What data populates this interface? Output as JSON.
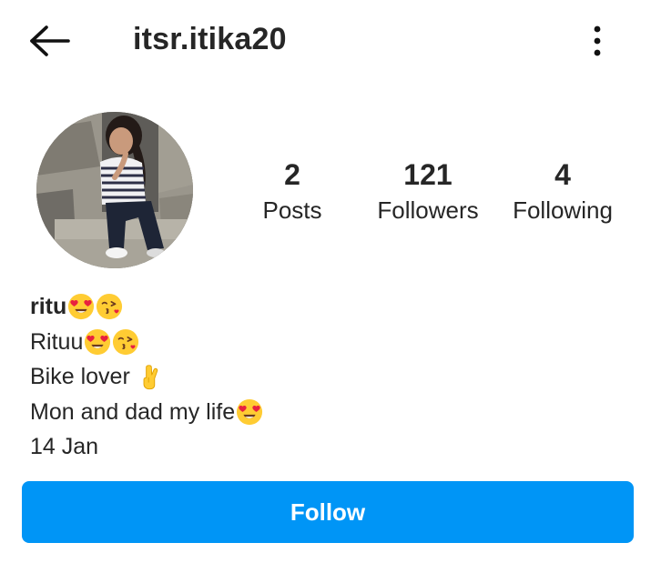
{
  "header": {
    "back_icon": "arrow-left-icon",
    "username": "itsr.itika20",
    "more_icon": "vertical-ellipsis-icon"
  },
  "profile": {
    "avatar_icon": "profile-photo",
    "stats": {
      "posts": {
        "count": "2",
        "label": "Posts"
      },
      "followers": {
        "count": "121",
        "label": "Followers"
      },
      "following": {
        "count": "4",
        "label": "Following"
      }
    }
  },
  "bio": {
    "name": "ritu",
    "line1": "Rituu",
    "line2": "Bike lover ",
    "line3": "Mon and dad my life",
    "line4": "14 Jan",
    "emoji_names": [
      "heart-eyes-emoji",
      "kiss-emoji",
      "crossed-fingers-emoji"
    ]
  },
  "actions": {
    "follow_label": "Follow",
    "accent_color": "#0095f6"
  }
}
